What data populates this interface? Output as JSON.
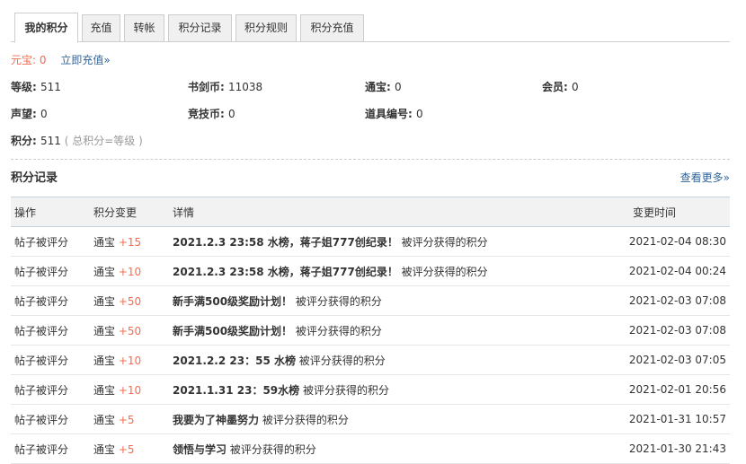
{
  "tabs": [
    "我的积分",
    "充值",
    "转帐",
    "积分记录",
    "积分规则",
    "积分充值"
  ],
  "yuanbao": {
    "label": "元宝: ",
    "value": "0",
    "link": "立即充值»"
  },
  "stats": [
    {
      "key": "等级: ",
      "value": "511"
    },
    {
      "key": "书剑币: ",
      "value": "11038"
    },
    {
      "key": "通宝: ",
      "value": "0"
    },
    {
      "key": "会员: ",
      "value": "0"
    },
    {
      "key": "声望: ",
      "value": "0"
    },
    {
      "key": "竞技币: ",
      "value": "0"
    },
    {
      "key": "道具编号: ",
      "value": "0"
    }
  ],
  "score": {
    "key": "积分: ",
    "value": "511",
    "note": " ( 总积分=等级 )"
  },
  "records": {
    "title": "积分记录",
    "more": "查看更多»",
    "headers": [
      "操作",
      "积分变更",
      "详情",
      "变更时间"
    ],
    "rows": [
      {
        "op": "帖子被评分",
        "currency": "通宝",
        "change": "+15",
        "subject": "2021.2.3 23:58 水榜，蒋子姐777创纪录！",
        "suffix": " 被评分获得的积分",
        "time": "2021-02-04 08:30"
      },
      {
        "op": "帖子被评分",
        "currency": "通宝",
        "change": "+10",
        "subject": "2021.2.3 23:58 水榜，蒋子姐777创纪录！",
        "suffix": " 被评分获得的积分",
        "time": "2021-02-04 00:24"
      },
      {
        "op": "帖子被评分",
        "currency": "通宝",
        "change": "+50",
        "subject": "新手满500级奖励计划！",
        "suffix": " 被评分获得的积分",
        "time": "2021-02-03 07:08"
      },
      {
        "op": "帖子被评分",
        "currency": "通宝",
        "change": "+50",
        "subject": "新手满500级奖励计划！",
        "suffix": " 被评分获得的积分",
        "time": "2021-02-03 07:08"
      },
      {
        "op": "帖子被评分",
        "currency": "通宝",
        "change": "+10",
        "subject": "2021.2.2 23：55 水榜",
        "suffix": " 被评分获得的积分",
        "time": "2021-02-03 07:05"
      },
      {
        "op": "帖子被评分",
        "currency": "通宝",
        "change": "+10",
        "subject": "2021.1.31 23：59水榜",
        "suffix": " 被评分获得的积分",
        "time": "2021-02-01 20:56"
      },
      {
        "op": "帖子被评分",
        "currency": "通宝",
        "change": "+5",
        "subject": "我要为了神墨努力",
        "suffix": " 被评分获得的积分",
        "time": "2021-01-31 10:57"
      },
      {
        "op": "帖子被评分",
        "currency": "通宝",
        "change": "+5",
        "subject": "领悟与学习",
        "suffix": " 被评分获得的积分",
        "time": "2021-01-30 21:43"
      }
    ]
  }
}
